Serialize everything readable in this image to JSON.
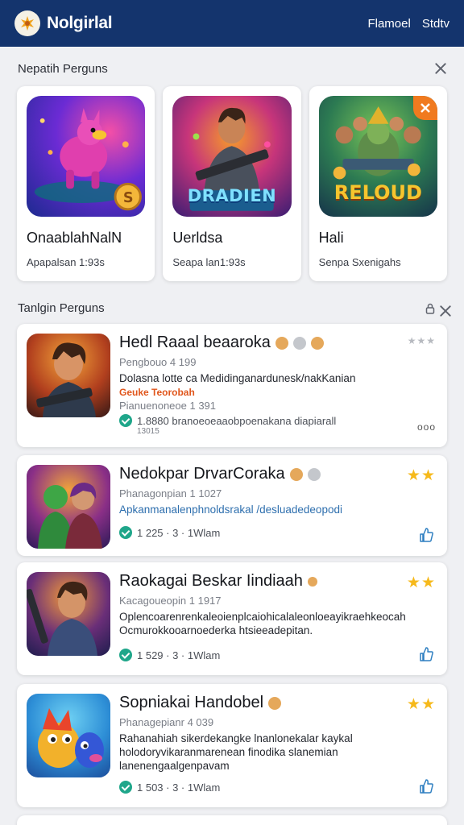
{
  "appbar": {
    "title": "Nolgirlal",
    "actions": [
      "Flamoel",
      "Stdtv"
    ]
  },
  "featured_section": {
    "title": "Nepatih Perguns"
  },
  "featured": [
    {
      "name": "OnaablahNalN",
      "subtitle": "Apapalsan 1:93s",
      "art": "pink dragon with gold coin"
    },
    {
      "name": "Uerldsa",
      "subtitle": "Seapa lan1:93s",
      "art": "DRADIEN soldier with rifle"
    },
    {
      "name": "Hali",
      "subtitle": "Senpa Sxenigahs",
      "art": "RELOUD warrior squad"
    }
  ],
  "list_section": {
    "title": "Tanlgin Perguns",
    "icons": [
      "lock-icon",
      "close-icon"
    ]
  },
  "items": [
    {
      "name": "Hedl Raaal beaaroka",
      "meta": "Pengbouo 4 199",
      "desc": "Dolasna lotte ca Medidinganardunesk/nakKanian",
      "tag": "Geuke Teorobah",
      "meta2": "Pianuenoneoe 1 391",
      "stat": "1.8880 branoeoeaaobpoenakana diapiarall",
      "stat2": "13015",
      "stars": "★★★",
      "corner": "ooo"
    },
    {
      "name": "Nedokpar DrvarCoraka",
      "meta": "Phanagonpian 1 1027",
      "desc": "Apkanmanalenphnoldsrakal /desluadedeopodi",
      "stat": "1 225 · 3 · 1Wlam",
      "stars": "★★"
    },
    {
      "name": "Raokagai Beskar Iindiaah",
      "meta": "Kacagoueopin 1 1917",
      "desc": "Oplencoarenrenkaleoienplcaiohicalaleonloeayikraehkeocah",
      "desc2": "Ocmurokkooarnoederka htsieeadepitan.",
      "stat": "1 529 · 3 · 1Wlam",
      "stars": "★★"
    },
    {
      "name": "Sopniakai Handobel",
      "meta": "Phanagepianr 4 039",
      "desc": "Rahanahiah sikerdekangke lnanlonekalar kaykal",
      "desc2": "holodoryvikaranmarenean finodika slanemian",
      "desc3": "lanenengaalgenpavam",
      "stat": "1 503 · 3 · 1Wlam",
      "stars": "★★"
    }
  ],
  "colors": {
    "appbar": "#14346d",
    "accent_green": "#1fa68a",
    "star": "#f6b91b",
    "tag": "#e0561c",
    "link_blue": "#2e6fae"
  }
}
